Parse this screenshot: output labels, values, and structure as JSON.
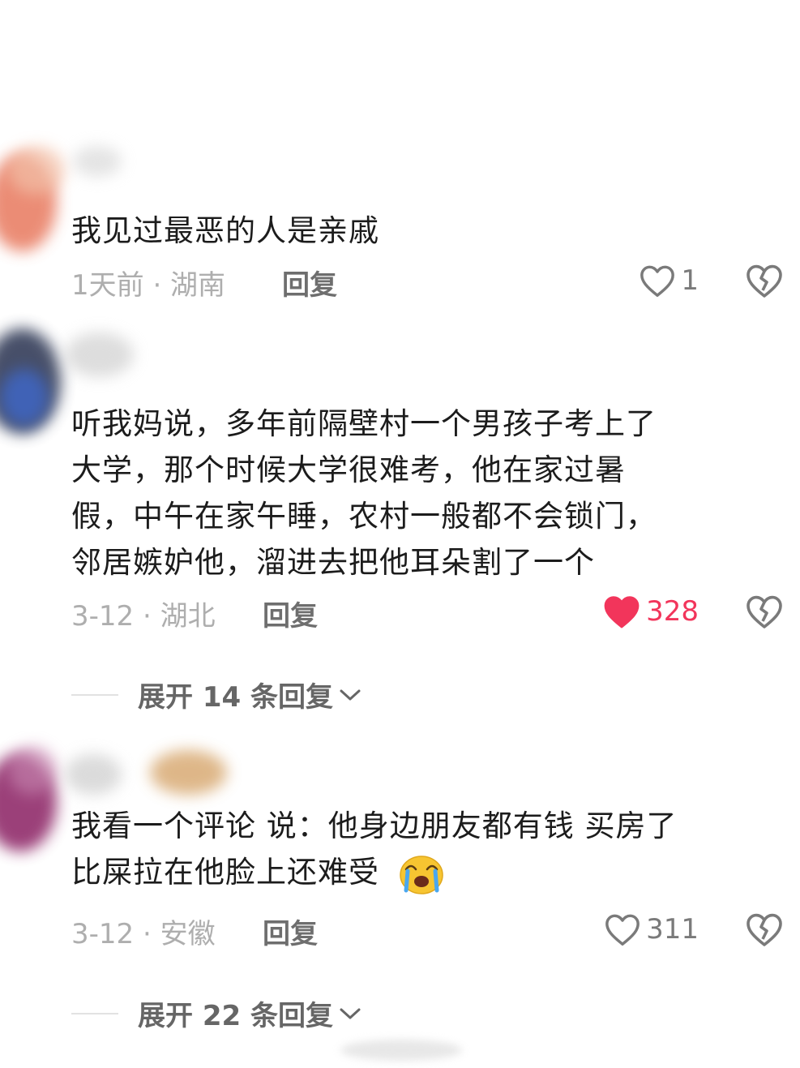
{
  "comments": [
    {
      "lines": [
        "我见过最恶的人是亲戚"
      ],
      "date_location": "1天前 · 湖南",
      "reply_label": "回复",
      "likes": "1",
      "liked": false
    },
    {
      "lines": [
        "听我妈说，多年前隔壁村一个男孩子考上了",
        "大学，那个时候大学很难考，他在家过暑",
        "假，中午在家午睡，农村一般都不会锁门，",
        "邻居嫉妒他，溜进去把他耳朵割了一个"
      ],
      "date_location": "3-12 · 湖北",
      "reply_label": "回复",
      "likes": "328",
      "liked": true,
      "expand_label": "展开 14 条回复"
    },
    {
      "lines": [
        "我看一个评论 说：他身边朋友都有钱 买房了",
        "比屎拉在他脸上还难受"
      ],
      "emoji": "crying-face-emoji",
      "date_location": "3-12 · 安徽",
      "reply_label": "回复",
      "likes": "311",
      "liked": false,
      "expand_label": "展开 22 条回复"
    }
  ],
  "colors": {
    "liked_heart": "#f2355b",
    "meta_gray": "#aeaeae"
  }
}
